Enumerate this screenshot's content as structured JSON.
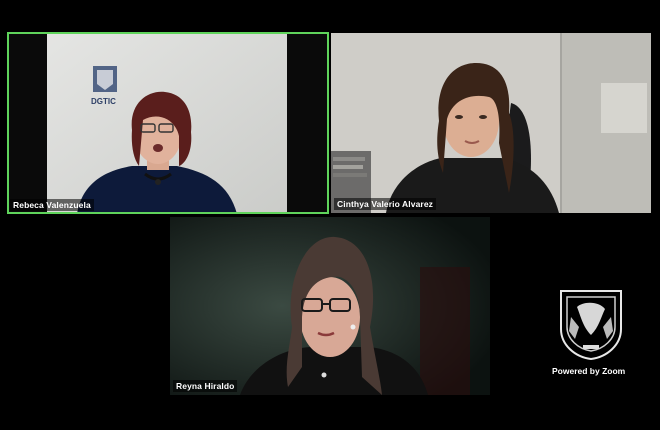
{
  "participants": [
    {
      "name": "Rebeca Valenzuela",
      "active_speaker": true
    },
    {
      "name": "Cinthya Valerio Alvarez",
      "active_speaker": false
    },
    {
      "name": "Reyna Hiraldo",
      "active_speaker": false
    }
  ],
  "backdrop_logo_text": "DGTIC",
  "branding": {
    "powered_by": "Powered by Zoom"
  },
  "colors": {
    "active_border": "#5fd35b",
    "background": "#000000"
  },
  "icons": [
    "unam-seal-icon",
    "unam-logo-icon"
  ]
}
